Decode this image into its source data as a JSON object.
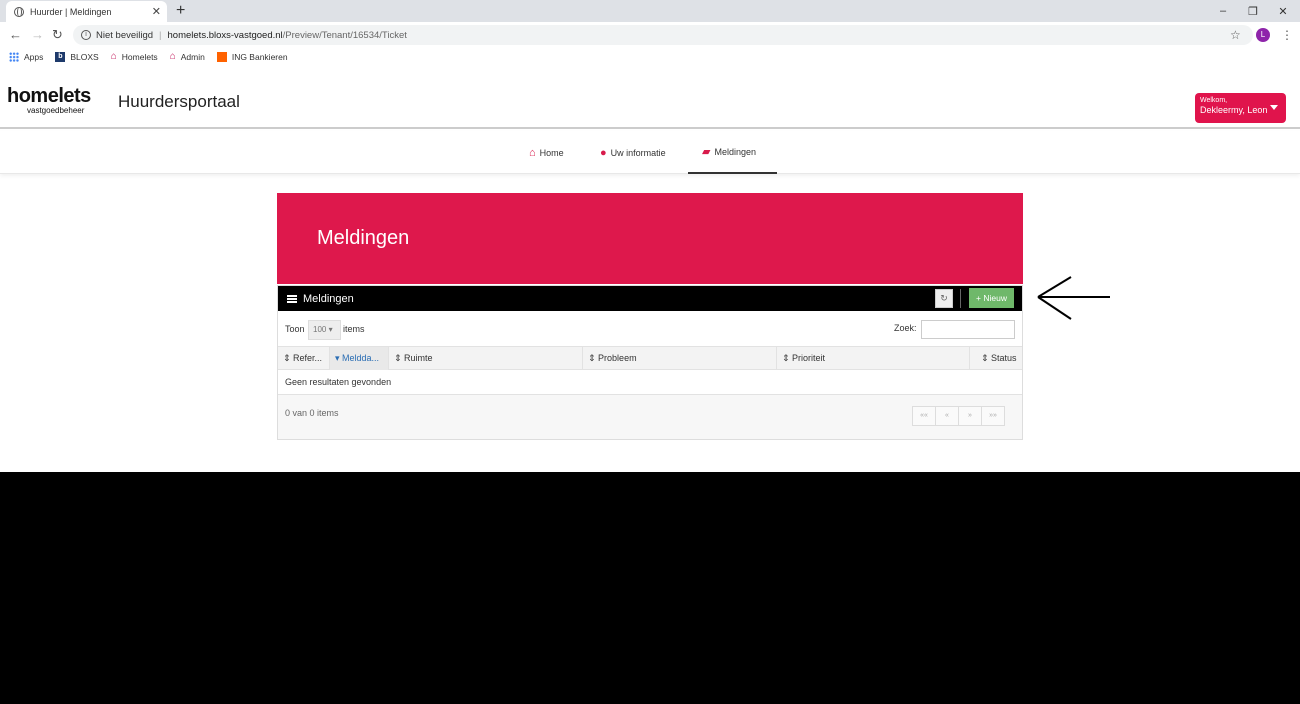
{
  "browser": {
    "tab_title": "Huurder | Meldingen",
    "tab_close": "✕",
    "new_tab": "+",
    "address": {
      "security": "Niet beveiligd",
      "host": "homelets.bloxs-vastgoed.nl",
      "path": "/Preview/Tenant/16534/Ticket"
    },
    "profile_initial": "L",
    "bookmarks": [
      "Apps",
      "BLOXS",
      "Homelets",
      "Admin",
      "ING Bankieren"
    ],
    "window_controls": [
      "–",
      "❐",
      "✕"
    ]
  },
  "site": {
    "logo": {
      "brand": "homelets",
      "tagline": "vastgoedbeheer"
    },
    "portal_title": "Huurdersportaal",
    "user_menu": {
      "greeting": "Welkom,",
      "name": "Dekleermy, Leon"
    },
    "nav": [
      {
        "label": "Home",
        "icon": "home-icon",
        "active": false
      },
      {
        "label": "Uw informatie",
        "icon": "user-icon",
        "active": false
      },
      {
        "label": "Meldingen",
        "icon": "folder-open-icon",
        "active": true
      }
    ]
  },
  "page": {
    "hero_title": "Meldingen",
    "panel": {
      "title": "Meldingen",
      "new_button": "Nieuw",
      "new_button_color": "#6fb86a",
      "show_label": "Toon",
      "page_size": "100",
      "items_label": "items",
      "search_label": "Zoek:",
      "columns": [
        "Refer...",
        "Meldda...",
        "Ruimte",
        "Probleem",
        "Prioriteit",
        "Status"
      ],
      "sorted_column": "Meldda...",
      "empty_message": "Geen resultaten gevonden",
      "count_text": "0 van 0 items",
      "pager": [
        "««",
        "«",
        "»",
        "»»"
      ]
    }
  },
  "colors": {
    "brand": "#de184c",
    "accent_green": "#6fb86a"
  }
}
